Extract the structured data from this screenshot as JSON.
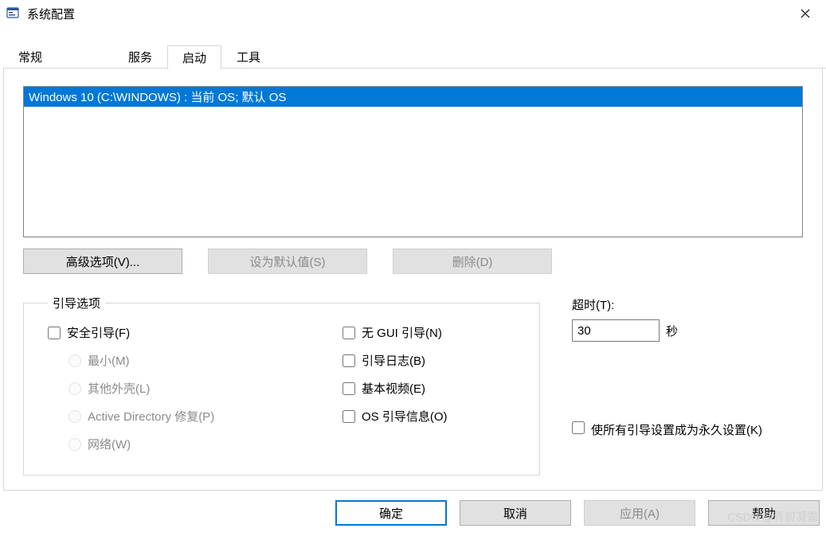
{
  "window": {
    "title": "系统配置",
    "close_icon": "close-icon"
  },
  "tabs": {
    "general": "常规",
    "services": "服务",
    "startup": "启动",
    "tools": "工具",
    "active_index": 2
  },
  "boot_list": {
    "item0": "Windows 10 (C:\\WINDOWS) : 当前 OS; 默认 OS"
  },
  "buttons": {
    "advanced": "高级选项(V)...",
    "set_default": "设为默认值(S)",
    "delete": "删除(D)",
    "ok": "确定",
    "cancel": "取消",
    "apply": "应用(A)",
    "help": "帮助"
  },
  "boot_options": {
    "legend": "引导选项",
    "safe_boot": "安全引导(F)",
    "minimal": "最小(M)",
    "alt_shell": "其他外壳(L)",
    "ad_repair": "Active Directory 修复(P)",
    "network": "网络(W)",
    "no_gui": "无 GUI 引导(N)",
    "boot_log": "引导日志(B)",
    "base_video": "基本视频(E)",
    "os_boot_info": "OS 引导信息(O)"
  },
  "timeout": {
    "label": "超时(T):",
    "value": "30",
    "unit": "秒"
  },
  "permanent": {
    "label": "使所有引导设置成为永久设置(K)"
  },
  "watermark": "CSDN @青碧凝霜"
}
